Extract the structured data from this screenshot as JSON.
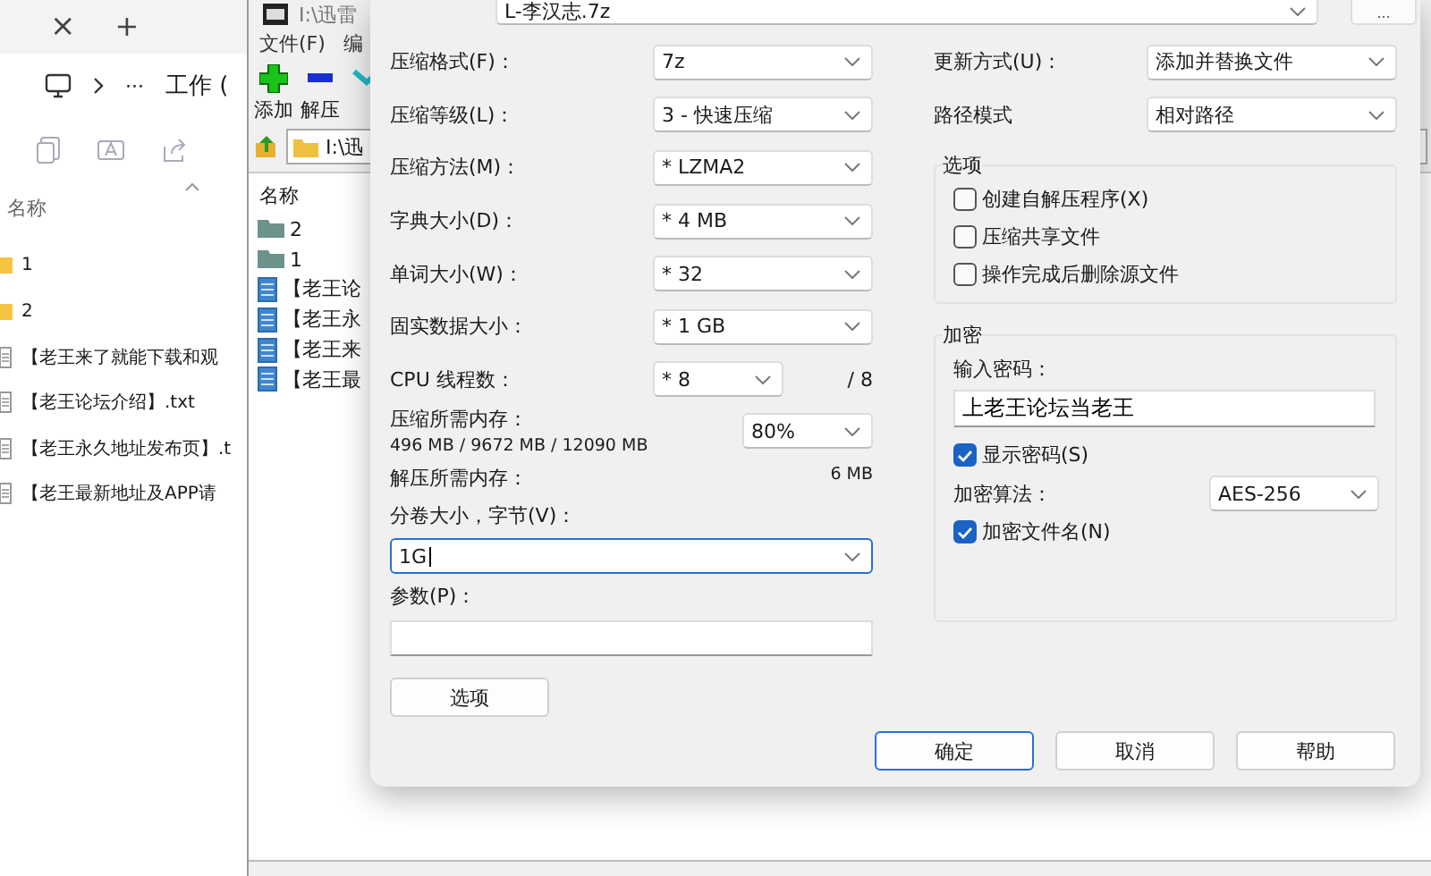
{
  "explorer": {
    "tab_close": "×",
    "new_tab": "+",
    "more": "···",
    "path": "工作 (",
    "column_header": "名称",
    "items": [
      {
        "kind": "folder",
        "name": "1"
      },
      {
        "kind": "folder",
        "name": "2"
      },
      {
        "kind": "file",
        "name": "【老王来了就能下载和观"
      },
      {
        "kind": "file",
        "name": "【老王论坛介绍】.txt"
      },
      {
        "kind": "file",
        "name": "【老王永久地址发布页】.t"
      },
      {
        "kind": "file",
        "name": "【老王最新地址及APP请"
      }
    ]
  },
  "archive_manager": {
    "title": "I:\\迅雷",
    "menu": [
      "文件(F)",
      "编"
    ],
    "toolbar": [
      {
        "kind": "add",
        "label": "添加"
      },
      {
        "kind": "extract",
        "label": "解压"
      },
      {
        "kind": "test"
      }
    ],
    "address": "I:\\迅",
    "column_header": "名称",
    "items": [
      {
        "kind": "folder",
        "name": "2"
      },
      {
        "kind": "folder",
        "name": "1"
      },
      {
        "kind": "file",
        "name": "【老王论"
      },
      {
        "kind": "file",
        "name": "【老王永"
      },
      {
        "kind": "file",
        "name": "【老王来"
      },
      {
        "kind": "file",
        "name": "【老王最"
      }
    ]
  },
  "dialog": {
    "archive_name": "L-李汉志.7z",
    "browse": "...",
    "fields": [
      {
        "label": "压缩格式(F)：",
        "value": "7z"
      },
      {
        "label": "压缩等级(L)：",
        "value": "3 - 快速压缩"
      },
      {
        "label": "压缩方法(M)：",
        "value": "* LZMA2"
      },
      {
        "label": "字典大小(D)：",
        "value": "* 4 MB"
      },
      {
        "label": "单词大小(W)：",
        "value": "* 32"
      },
      {
        "label": "固实数据大小：",
        "value": "* 1 GB"
      },
      {
        "label": "CPU 线程数：",
        "value": "* 8",
        "suffix": "/ 8"
      }
    ],
    "memory": {
      "label": "压缩所需内存：",
      "detail": "496 MB / 9672 MB / 12090 MB",
      "value": "80%"
    },
    "decompress_memory": {
      "label": "解压所需内存：",
      "value": "6 MB"
    },
    "volume": {
      "label": "分卷大小，字节(V)：",
      "value": "1G",
      "focused": true
    },
    "parameters": {
      "label": "参数(P)："
    },
    "options_button": "选项",
    "update_mode": {
      "label": "更新方式(U)：",
      "value": "添加并替换文件"
    },
    "path_mode": {
      "label": "路径模式",
      "value": "相对路径"
    },
    "options": {
      "title": "选项",
      "checkboxes": [
        {
          "label": "创建自解压程序(X)",
          "checked": false
        },
        {
          "label": "压缩共享文件",
          "checked": false
        },
        {
          "label": "操作完成后删除源文件",
          "checked": false
        }
      ]
    },
    "encryption": {
      "title": "加密",
      "password_label": "输入密码：",
      "password": "上老王论坛当老王",
      "show_password": {
        "label": "显示密码(S)",
        "checked": true
      },
      "method_label": "加密算法：",
      "method": "AES-256",
      "encrypt_names": {
        "label": "加密文件名(N)",
        "checked": true
      }
    },
    "buttons": [
      {
        "label": "确定",
        "default": true
      },
      {
        "label": "取消",
        "default": false
      },
      {
        "label": "帮助",
        "default": false
      }
    ]
  }
}
